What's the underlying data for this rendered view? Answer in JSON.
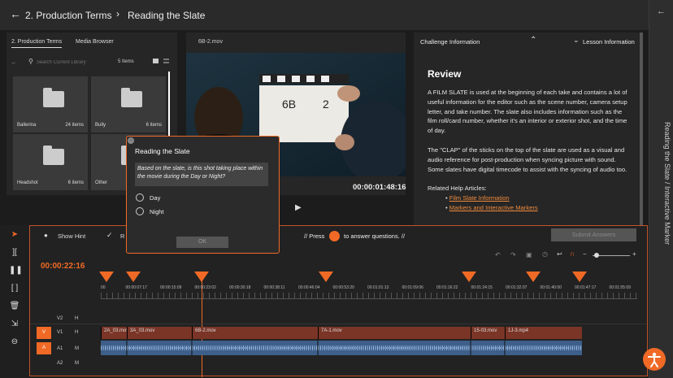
{
  "header": {
    "breadcrumb_parent": "2. Production Terms",
    "breadcrumb_current": "Reading the Slate"
  },
  "rail": {
    "vertical_title": "Reading the Slate / Interactive Marker"
  },
  "library": {
    "tabs": [
      "2. Production Terms",
      "Media Browser"
    ],
    "search_placeholder": "Search Current Library",
    "item_count": "5 Items",
    "tiles": [
      {
        "name": "Ballerina",
        "count": "24 items"
      },
      {
        "name": "Bully",
        "count": "6 items"
      },
      {
        "name": "Headshot",
        "count": "6 items"
      },
      {
        "name": "Other",
        "count": ""
      }
    ]
  },
  "viewer": {
    "filename": "6B-2.mov",
    "timecode": "00:00:01:48:16"
  },
  "challenge": {
    "tab_challenge": "Challenge Information",
    "tab_lesson": "Lesson Information",
    "heading": "Review",
    "para1": "A FILM SLATE is used at the beginning of each take and contains a lot of useful information for the editor such as the scene number, camera setup letter, and take number. The slate also includes information such as the film roll/card number, whether it's an interior or exterior shot, and the time of day.",
    "para2": "The \"CLAP\" of the sticks on the top of the slate are used as a visual and audio reference for post-production when syncing picture with sound. Some slates have digital timecode to assist with the syncing of audio too.",
    "related": "Related Help Articles:",
    "links": [
      "Film Slate Information",
      "Markers and Interactive Markers"
    ]
  },
  "modal": {
    "title": "Reading the Slate",
    "question": "Based on the slate, is this shot taking place within the movie during the Day or Night?",
    "options": [
      "Day",
      "Night"
    ],
    "ok": "OK"
  },
  "timeline": {
    "show_hint": "Show Hint",
    "reset_partial": "R",
    "press_prefix": "// Press",
    "press_suffix": "to answer questions. //",
    "submit": "Submit Answers",
    "current_tc": "00:00:22:16",
    "ruler": [
      "00",
      "00:00:07:17",
      "00:00:15:09",
      "00:00:23:02",
      "00:00:30:18",
      "00:00:38:11",
      "00:00:46:04",
      "00:00:53:20",
      "00:01:01:13",
      "00:01:09:06",
      "00:01:16:22",
      "00:01:24:15",
      "00:01:32:07",
      "00:01:40:00",
      "00:01:47:17",
      "00:01:55:09"
    ],
    "tracks": {
      "v2": "V2",
      "v1": "V1",
      "a1": "A1",
      "a2": "A2",
      "h": "H",
      "m": "M",
      "v_btn": "V",
      "a_btn": "A"
    },
    "clips": [
      "2A_03.mov",
      "3A_03.mov",
      "6B-2.mov",
      "7A-1.mov",
      "15-03.mov",
      "1J-3.mp4"
    ],
    "colors": {
      "accent": "#f06a26",
      "clip": "#7a3527",
      "audio": "#3d5f8a"
    }
  }
}
